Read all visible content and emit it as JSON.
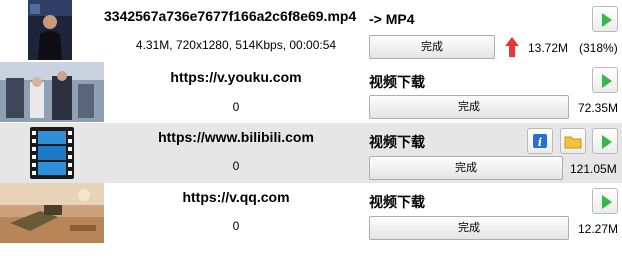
{
  "items": [
    {
      "title": "3342567a736e7677f166a2c6f8e69.mp4",
      "subtitle": "4.31M, 720x1280, 514Kbps, 00:00:54",
      "status": "-> MP4",
      "button_label": "完成",
      "size": "13.72M",
      "ratio": "(318%)"
    },
    {
      "title": "https://v.youku.com",
      "subtitle": "0",
      "status": "视频下载",
      "button_label": "完成",
      "size": "72.35M"
    },
    {
      "title": "https://www.bilibili.com",
      "subtitle": "0",
      "status": "视频下载",
      "button_label": "完成",
      "size": "121.05M"
    },
    {
      "title": "https://v.qq.com",
      "subtitle": "0",
      "status": "视频下载",
      "button_label": "完成",
      "size": "12.27M"
    }
  ],
  "colors": {
    "play_green": "#39b54a",
    "arrow_red": "#e53935",
    "selected_row": "#e6e6e6"
  },
  "icons": [
    "play-icon",
    "up-arrow-icon",
    "info-icon",
    "folder-icon",
    "film-icon"
  ]
}
